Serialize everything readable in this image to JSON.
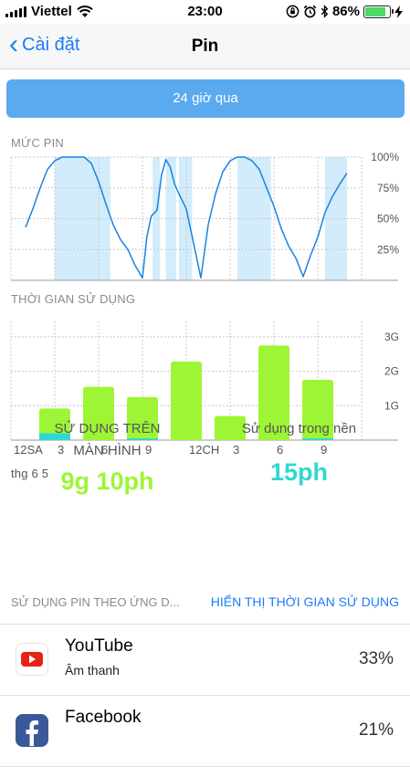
{
  "status_bar": {
    "carrier": "Viettel",
    "time": "23:00",
    "battery": "86%",
    "battery_level": 0.86,
    "icons": [
      "signal-icon",
      "wifi-icon",
      "orientation-lock-icon",
      "alarm-icon",
      "bluetooth-icon",
      "battery-icon",
      "charging-icon"
    ]
  },
  "nav": {
    "back_label": "Cài đặt",
    "title": "Pin"
  },
  "range_button": "24 giờ qua",
  "battery_level_section": {
    "label": "MỨC PIN"
  },
  "usage_time_section": {
    "label": "THỜI GIAN SỬ DỤNG",
    "date_label": "thg 6 5"
  },
  "chart_data": [
    {
      "type": "line",
      "title": "MỨC PIN",
      "x_unit": "hour",
      "xlim": [
        0,
        24
      ],
      "ylim": [
        0,
        100
      ],
      "y_ticks": [
        "100%",
        "75%",
        "50%",
        "25%"
      ],
      "y_tick_values": [
        100,
        75,
        50,
        25
      ],
      "x": [
        1.0,
        1.5,
        2.0,
        2.5,
        3.0,
        3.5,
        4.0,
        5.0,
        5.5,
        6.0,
        6.5,
        7.0,
        7.5,
        8.0,
        8.5,
        9.0,
        9.3,
        9.6,
        10.0,
        10.3,
        10.6,
        10.9,
        11.2,
        11.5,
        12.0,
        12.5,
        13.0,
        13.5,
        14.0,
        14.5,
        15.0,
        15.5,
        16.0,
        16.5,
        17.0,
        17.5,
        18.0,
        18.5,
        19.0,
        19.5,
        20.0,
        20.5,
        21.0,
        21.5,
        22.0,
        22.5,
        23.0
      ],
      "y": [
        43,
        58,
        75,
        90,
        97,
        100,
        100,
        100,
        95,
        80,
        62,
        45,
        33,
        25,
        12,
        2,
        35,
        52,
        57,
        85,
        98,
        92,
        78,
        70,
        58,
        30,
        2,
        45,
        70,
        88,
        97,
        100,
        100,
        97,
        90,
        75,
        60,
        42,
        28,
        18,
        3,
        20,
        35,
        55,
        68,
        78,
        87
      ],
      "charging_periods": [
        [
          3,
          6.8
        ],
        [
          9.7,
          10.2
        ],
        [
          10.6,
          11.3
        ],
        [
          11.5,
          12.4
        ],
        [
          15.5,
          17.8
        ],
        [
          21.5,
          23.0
        ]
      ],
      "grid": true,
      "colors": {
        "line": "#1a83e0",
        "charging": "#d2ecfb"
      }
    },
    {
      "type": "bar",
      "title": "THỜI GIAN SỬ DỤNG",
      "categories": [
        "12SA",
        "3",
        "6",
        "9",
        "12CH",
        "3",
        "6",
        "9"
      ],
      "ylim": [
        0,
        3
      ],
      "y_ticks": [
        "3G",
        "2G",
        "1G"
      ],
      "y_tick_values": [
        3,
        2,
        1
      ],
      "series": [
        {
          "name": "Sử dụng trên màn hình",
          "values": [
            0.92,
            1.55,
            1.25,
            2.28,
            0.7,
            2.75,
            1.75
          ],
          "color": "#9ef535"
        },
        {
          "name": "Sử dụng trong nền",
          "values": [
            0.2,
            0.0,
            0.05,
            0.0,
            0.0,
            0.0,
            0.05
          ],
          "color": "#30d8d0"
        }
      ],
      "grid": true
    }
  ],
  "stats": {
    "screen_label_1": "SỬ DỤNG TRÊN",
    "screen_label_2": "MÀN HÌNH",
    "screen_value": "9g 10ph",
    "screen_color": "#9ef535",
    "background_label": "Sử dụng trong nền",
    "background_value": "15ph",
    "background_color": "#30d8d0"
  },
  "app_usage": {
    "header": "SỬ DỤNG PIN THEO ỨNG D...",
    "toggle": "HIỂN THỊ THỜI GIAN SỬ DỤNG",
    "apps": [
      {
        "name": "YouTube",
        "sub": "Âm thanh",
        "percent": "33%",
        "icon": "youtube-icon"
      },
      {
        "name": "Facebook",
        "sub": "",
        "percent": "21%",
        "icon": "facebook-icon"
      }
    ]
  }
}
